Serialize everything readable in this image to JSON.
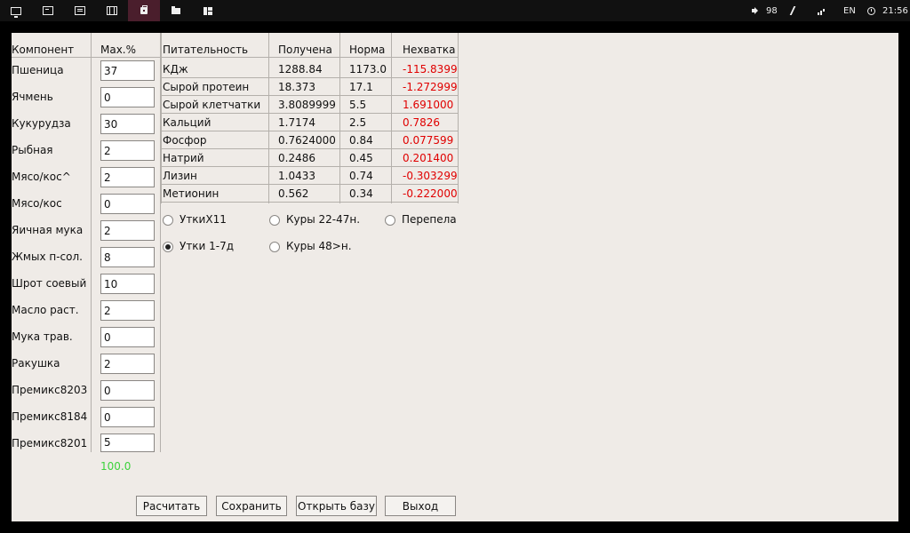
{
  "taskbar": {
    "apps": [
      {
        "icon": "monitor-icon"
      },
      {
        "icon": "terminal-icon"
      },
      {
        "icon": "list-icon"
      },
      {
        "icon": "film-icon"
      },
      {
        "icon": "shopping-bag-icon",
        "active": true
      },
      {
        "icon": "folder-icon"
      },
      {
        "icon": "panels-icon"
      }
    ],
    "volume": "98",
    "language": "EN",
    "clock": "21:56"
  },
  "ingredients": {
    "header_component": "Компонент",
    "header_max": "Max.%",
    "rows": [
      {
        "name": "Пшеница",
        "value": "37"
      },
      {
        "name": "Ячмень",
        "value": "0"
      },
      {
        "name": "Кукурудза",
        "value": "30"
      },
      {
        "name": "Рыбная",
        "value": "2"
      },
      {
        "name": "Мясо/кос^",
        "value": "2"
      },
      {
        "name": "Мясо/кос",
        "value": "0"
      },
      {
        "name": "Яичная мука",
        "value": "2"
      },
      {
        "name": "Жмых п-сол.",
        "value": "8"
      },
      {
        "name": "Шрот соевый",
        "value": "10"
      },
      {
        "name": "Масло раст.",
        "value": "2"
      },
      {
        "name": "Мука трав.",
        "value": "0"
      },
      {
        "name": "Ракушка",
        "value": "2"
      },
      {
        "name": "Премикс8203",
        "value": "0"
      },
      {
        "name": "Премикс8184",
        "value": "0"
      },
      {
        "name": "Премикс8201",
        "value": "5"
      }
    ],
    "total": "100.0"
  },
  "nutrients": {
    "headers": [
      "Питательность",
      "Получена",
      "Норма",
      "Нехватка"
    ],
    "rows": [
      {
        "name": "КДж",
        "got": "1288.84",
        "norm": "1173.0",
        "diff": "-115.8399"
      },
      {
        "name": "Сырой протеин",
        "got": "18.373",
        "norm": "17.1",
        "diff": "-1.272999"
      },
      {
        "name": "Сырой клетчатки",
        "got": "3.8089999",
        "norm": "5.5",
        "diff": "1.691000"
      },
      {
        "name": "Кальций",
        "got": "1.7174",
        "norm": "2.5",
        "diff": "0.7826"
      },
      {
        "name": "Фосфор",
        "got": "0.7624000",
        "norm": "0.84",
        "diff": "0.077599"
      },
      {
        "name": "Натрий",
        "got": "0.2486",
        "norm": "0.45",
        "diff": "0.201400"
      },
      {
        "name": "Лизин",
        "got": "1.0433",
        "norm": "0.74",
        "diff": "-0.303299"
      },
      {
        "name": "Метионин",
        "got": "0.562",
        "norm": "0.34",
        "diff": "-0.222000"
      }
    ]
  },
  "presets": [
    {
      "label": "УткиХ11",
      "checked": false
    },
    {
      "label": "Куры 22-47н.",
      "checked": false
    },
    {
      "label": "Перепела",
      "checked": false
    },
    {
      "label": "Утки 1-7д",
      "checked": true
    },
    {
      "label": "Куры 48>н.",
      "checked": false
    }
  ],
  "buttons": {
    "calculate": "Расчитать",
    "save": "Сохранить",
    "open_base": "Открыть базу",
    "exit": "Выход"
  },
  "colors": {
    "deficit": "#e00000",
    "total": "#3cd23c",
    "active_tab": "#4a1e2c"
  }
}
